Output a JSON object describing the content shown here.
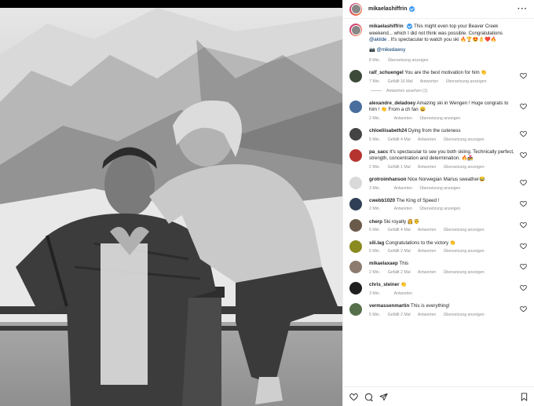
{
  "post": {
    "username": "mikaelashiffrin",
    "more_icon": "ellipsis-icon"
  },
  "caption": {
    "username": "mikaelashiffrin",
    "text": "This might even top your Beaver Creek weekend... which I did not think was possible. Congratulations",
    "mention": "@akilde",
    "text2": ". It's spectacular to watch you ski",
    "emojis": "🔥🏆😍👌❤️🔥",
    "credit_mention": "@mikedawsy",
    "time": "8 Min.",
    "translate": "Übersetzung anzeigen"
  },
  "comments": [
    {
      "user": "ralf_schuengel",
      "text": "You are the best motivation for him 👏",
      "time": "7 Min.",
      "likes": "Gefällt 16 Mal",
      "reply": "Antworten",
      "translate": "Übersetzung anzeigen",
      "avatar": "#3d4a3a"
    },
    {
      "user": "alexandre_deladoey",
      "text": "Amazing ski in Wengen ! Huge congrats to him ! 👏 From a ch fan 😀",
      "time": "2 Min.",
      "likes": "",
      "reply": "Antworten",
      "translate": "Übersetzung anzeigen",
      "avatar": "#4a6e9e"
    },
    {
      "user": "chloeliisabeth24",
      "text": "Dying from the cuteness",
      "time": "5 Min.",
      "likes": "Gefällt 4 Mal",
      "reply": "Antworten",
      "translate": "Übersetzung anzeigen",
      "avatar": "#444444"
    },
    {
      "user": "pa_sacc",
      "text": "It's spectacular to see you both skiing. Technically perfect, strength, concentration and determination. 🔥👩‍❤️‍👨",
      "time": "2 Min.",
      "likes": "Gefällt 1 Mal",
      "reply": "Antworten",
      "translate": "Übersetzung anzeigen",
      "avatar": "#b5342f"
    },
    {
      "user": "grotroimhanson",
      "text": "Nice Norwegian Marius sweather😂",
      "time": "3 Min.",
      "likes": "",
      "reply": "Antworten",
      "translate": "Übersetzung anzeigen",
      "avatar": "#d9d9d9"
    },
    {
      "user": "cwebb1020",
      "text": "The King of Speed !",
      "time": "2 Min.",
      "likes": "",
      "reply": "Antworten",
      "translate": "Übersetzung anzeigen",
      "avatar": "#2f3f55"
    },
    {
      "user": "cherp",
      "text": "Ski royalty 👸🤴",
      "time": "6 Min.",
      "likes": "Gefällt 4 Mal",
      "reply": "Antworten",
      "translate": "Übersetzung anzeigen",
      "avatar": "#6b5a4a"
    },
    {
      "user": "sili.lag",
      "text": "Congratulations to the victory 👏",
      "time": "5 Min.",
      "likes": "Gefällt 2 Mal",
      "reply": "Antworten",
      "translate": "Übersetzung anzeigen",
      "avatar": "#8a8a20"
    },
    {
      "user": "mikaelaxaep",
      "text": "This",
      "time": "2 Min.",
      "likes": "Gefällt 2 Mal",
      "reply": "Antworten",
      "translate": "Übersetzung anzeigen",
      "avatar": "#8c7b6e"
    },
    {
      "user": "chris_steiner",
      "text": "👏",
      "time": "3 Min.",
      "likes": "",
      "reply": "Antworten",
      "translate": "",
      "avatar": "#1f1f1f"
    },
    {
      "user": "vermassenmartin",
      "text": "This is everything!",
      "time": "5 Min.",
      "likes": "Gefällt 2 Mal",
      "reply": "Antworten",
      "translate": "Übersetzung anzeigen",
      "avatar": "#55704a"
    }
  ],
  "view_replies": "Antworten ansehen (1)",
  "colors": {
    "link": "#00376b",
    "meta": "#8e8e8e",
    "verified": "#3897f0"
  },
  "footer_icons": [
    "heart-icon",
    "comment-icon",
    "share-icon",
    "bookmark-icon"
  ]
}
